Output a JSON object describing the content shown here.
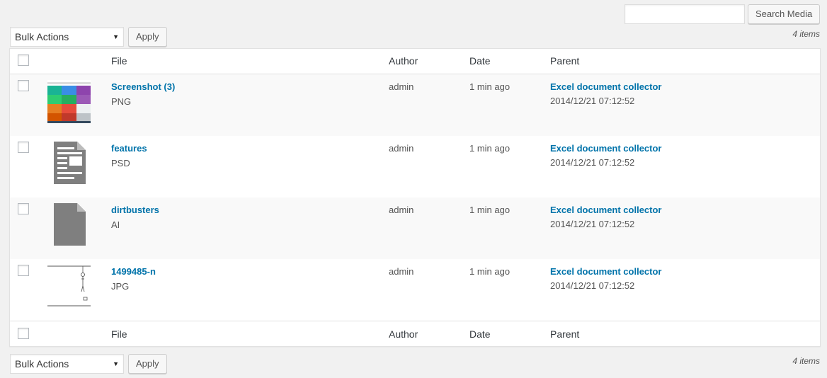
{
  "search": {
    "placeholder": "",
    "value": "",
    "button": "Search Media"
  },
  "bulk": {
    "selected": "Bulk Actions",
    "apply": "Apply"
  },
  "item_count": "4 items",
  "columns": {
    "file": "File",
    "author": "Author",
    "date": "Date",
    "parent": "Parent"
  },
  "rows": [
    {
      "title": "Screenshot (3)",
      "type": "PNG",
      "author": "admin",
      "date": "1 min ago",
      "parent": "Excel document collector",
      "parent_date": "2014/12/21 07:12:52",
      "thumb": "screenshot-thumbnail"
    },
    {
      "title": "features",
      "type": "PSD",
      "author": "admin",
      "date": "1 min ago",
      "parent": "Excel document collector",
      "parent_date": "2014/12/21 07:12:52",
      "thumb": "document-icon"
    },
    {
      "title": "dirtbusters",
      "type": "AI",
      "author": "admin",
      "date": "1 min ago",
      "parent": "Excel document collector",
      "parent_date": "2014/12/21 07:12:52",
      "thumb": "file-icon"
    },
    {
      "title": "1499485-n",
      "type": "JPG",
      "author": "admin",
      "date": "1 min ago",
      "parent": "Excel document collector",
      "parent_date": "2014/12/21 07:12:52",
      "thumb": "sketch-thumbnail"
    }
  ],
  "colors": {
    "link": "#0073aa",
    "background": "#f1f1f1"
  }
}
